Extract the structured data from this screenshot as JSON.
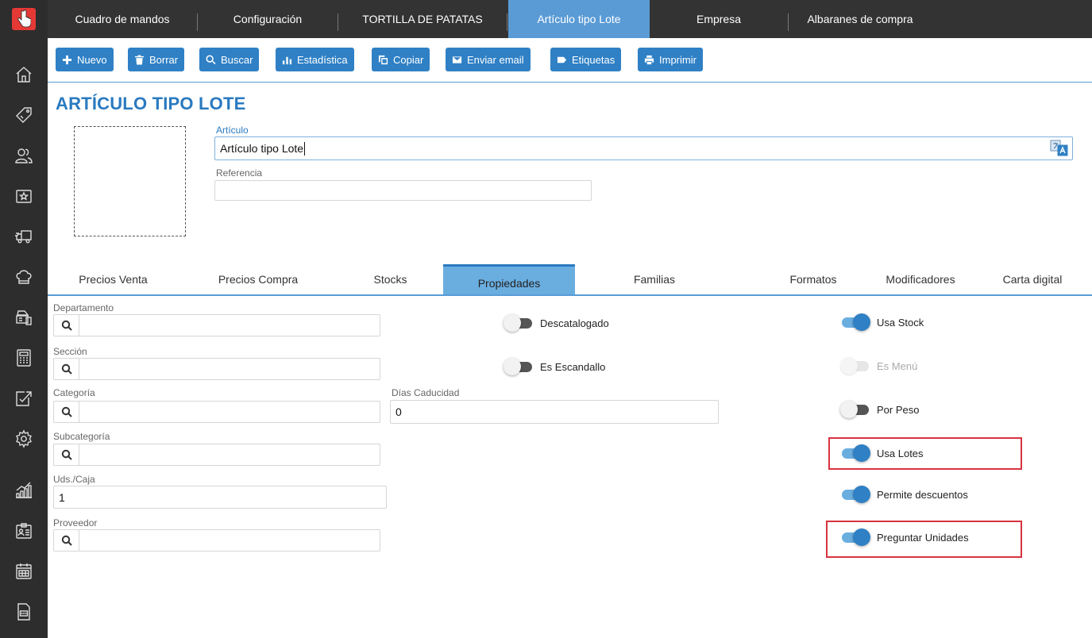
{
  "colors": {
    "accent": "#2f80c5",
    "active_tab": "#5a9bd5",
    "highlight": "#d9333f",
    "sidebar": "#2d2d2d"
  },
  "sidebar": {
    "icons": [
      "home-icon",
      "tag-icon",
      "users-icon",
      "star-card-icon",
      "truck-icon",
      "chef-hat-icon",
      "cash-register-icon",
      "calculator-icon",
      "edit-export-icon",
      "settings-icon",
      "stats-chart-icon",
      "id-card-icon",
      "calendar-icon",
      "document-icon"
    ]
  },
  "top_tabs": [
    {
      "label": "Cuadro de mandos"
    },
    {
      "label": "Configuración"
    },
    {
      "label": "TORTILLA DE PATATAS"
    },
    {
      "label": "Artículo tipo Lote"
    },
    {
      "label": "Empresa"
    },
    {
      "label": "Albaranes de compra"
    }
  ],
  "toolbar": {
    "nuevo": "Nuevo",
    "borrar": "Borrar",
    "buscar": "Buscar",
    "estadistica": "Estadística",
    "copiar": "Copiar",
    "enviar_email": "Enviar email",
    "etiquetas": "Etiquetas",
    "imprimir": "Imprimir"
  },
  "page": {
    "title": "ARTÍCULO TIPO LOTE",
    "articulo_label": "Artículo",
    "articulo_value": "Artículo tipo Lote",
    "referencia_label": "Referencia",
    "referencia_value": ""
  },
  "sub_tabs": [
    {
      "label": "Precios Venta"
    },
    {
      "label": "Precios Compra"
    },
    {
      "label": "Stocks"
    },
    {
      "label": "Propiedades"
    },
    {
      "label": "Familias"
    },
    {
      "label": "Formatos"
    },
    {
      "label": "Modificadores"
    },
    {
      "label": "Carta digital"
    }
  ],
  "fields": {
    "departamento": "Departamento",
    "seccion": "Sección",
    "categoria": "Categoría",
    "subcategoria": "Subcategoría",
    "uds_caja_label": "Uds./Caja",
    "uds_caja_value": "1",
    "proveedor": "Proveedor",
    "dias_caducidad_label": "Días Caducidad",
    "dias_caducidad_value": "0"
  },
  "toggles": {
    "descatalogado": {
      "label": "Descatalogado",
      "on": false
    },
    "es_escandallo": {
      "label": "Es Escandallo",
      "on": false
    },
    "usa_stock": {
      "label": "Usa Stock",
      "on": true
    },
    "es_menu": {
      "label": "Es Menú",
      "on": false,
      "disabled": true
    },
    "por_peso": {
      "label": "Por Peso",
      "on": false
    },
    "usa_lotes": {
      "label": "Usa Lotes",
      "on": true
    },
    "permite_descuentos": {
      "label": "Permite descuentos",
      "on": true
    },
    "preguntar_unidades": {
      "label": "Preguntar Unidades",
      "on": true
    }
  }
}
